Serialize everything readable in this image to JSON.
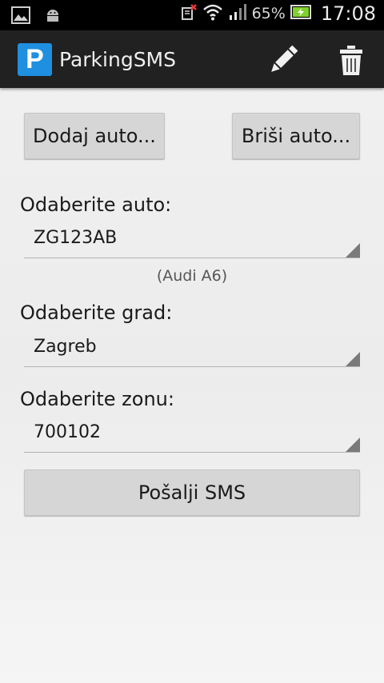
{
  "status_bar": {
    "battery_percent": "65%",
    "time": "17:08"
  },
  "action_bar": {
    "logo_letter": "P",
    "title": "ParkingSMS"
  },
  "buttons": {
    "add_car": "Dodaj auto...",
    "delete_car": "Briši auto...",
    "send_sms": "Pošalji SMS"
  },
  "form": {
    "car_label": "Odaberite auto:",
    "car_value": "ZG123AB",
    "car_model": "(Audi A6)",
    "city_label": "Odaberite grad:",
    "city_value": "Zagreb",
    "zone_label": "Odaberite zonu:",
    "zone_value": "700102"
  },
  "colors": {
    "logo_blue": "#1f8fe0",
    "action_bar": "#212121",
    "button": "#d6d6d6",
    "battery_green": "#7fd12e"
  }
}
